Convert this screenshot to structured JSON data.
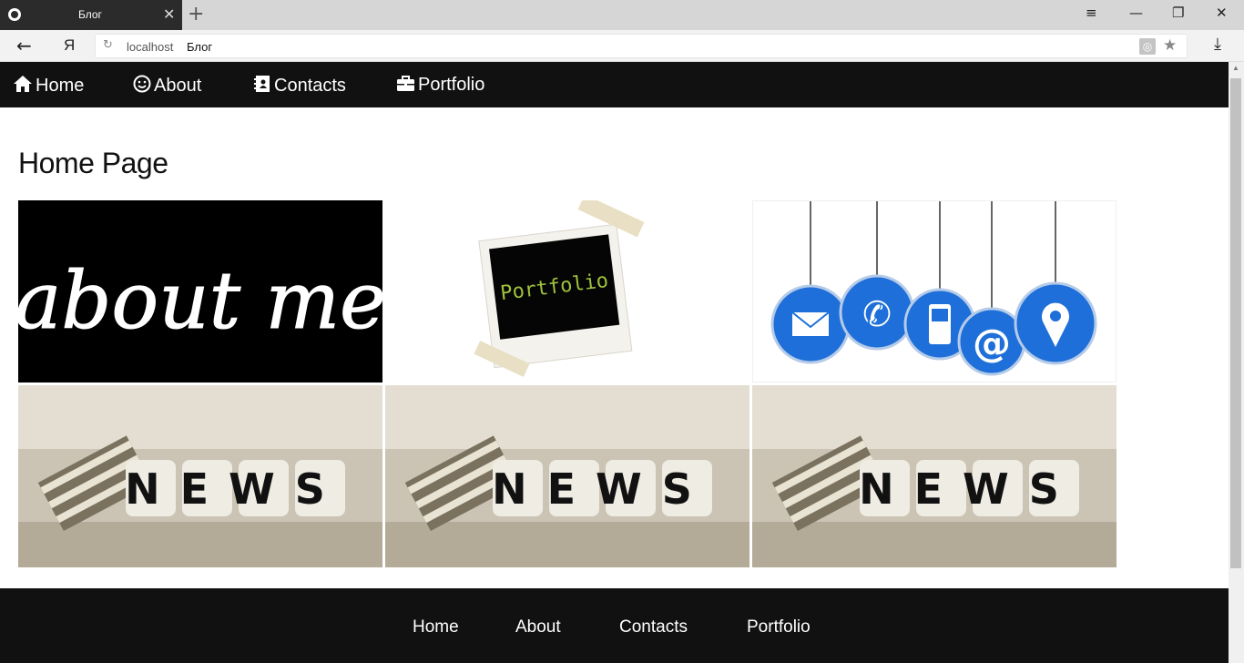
{
  "browser": {
    "tab_title": "Блог",
    "tab_close": "✕",
    "new_tab": "+",
    "url_host": "localhost",
    "url_title": "Блог",
    "ya_label": "Я"
  },
  "topnav": [
    {
      "label": "Home",
      "icon": "home-icon"
    },
    {
      "label": "About",
      "icon": "smile-icon"
    },
    {
      "label": "Contacts",
      "icon": "address-book-icon"
    },
    {
      "label": "Portfolio",
      "icon": "briefcase-icon"
    }
  ],
  "main": {
    "title": "Home Page",
    "tiles": [
      {
        "name": "about-me-image",
        "text": "about me"
      },
      {
        "name": "portfolio-image",
        "text": "Portfolio"
      },
      {
        "name": "contacts-image",
        "text": ""
      },
      {
        "name": "news-image-1",
        "text": "NEWS"
      },
      {
        "name": "news-image-2",
        "text": "NEWS"
      },
      {
        "name": "news-image-3",
        "text": "NEWS"
      }
    ]
  },
  "footer": [
    "Home",
    "About",
    "Contacts",
    "Portfolio"
  ],
  "colors": {
    "nav_bg": "#111111",
    "contact_blue": "#1e6fd9",
    "portfolio_green": "#9ec23a"
  }
}
